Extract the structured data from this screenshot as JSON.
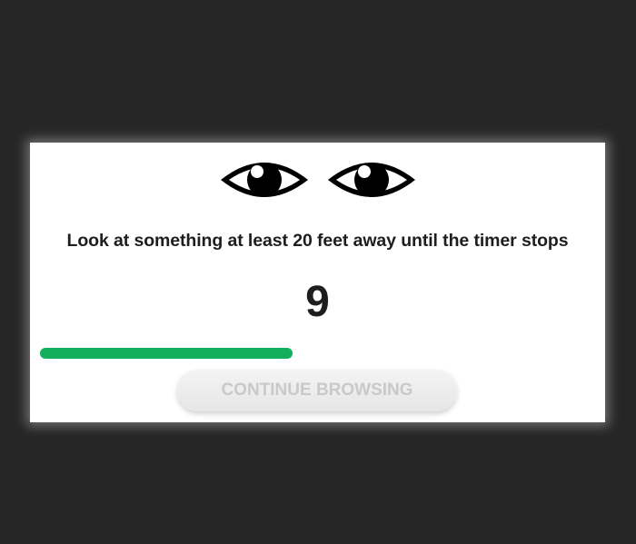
{
  "icons": {
    "left_eye": "eye-icon",
    "right_eye": "eye-icon"
  },
  "message": "Look at something at least 20 feet away until the timer stops",
  "timer": {
    "value": "9"
  },
  "progress": {
    "fraction": 0.5,
    "color": "#12b05c"
  },
  "continue_button": {
    "label": "CONTINUE BROWSING",
    "state": "disabled"
  },
  "colors": {
    "background": "#262626",
    "dialog": "#ffffff",
    "text": "#1e1e1e",
    "button_text_disabled": "#c9c9c9"
  }
}
